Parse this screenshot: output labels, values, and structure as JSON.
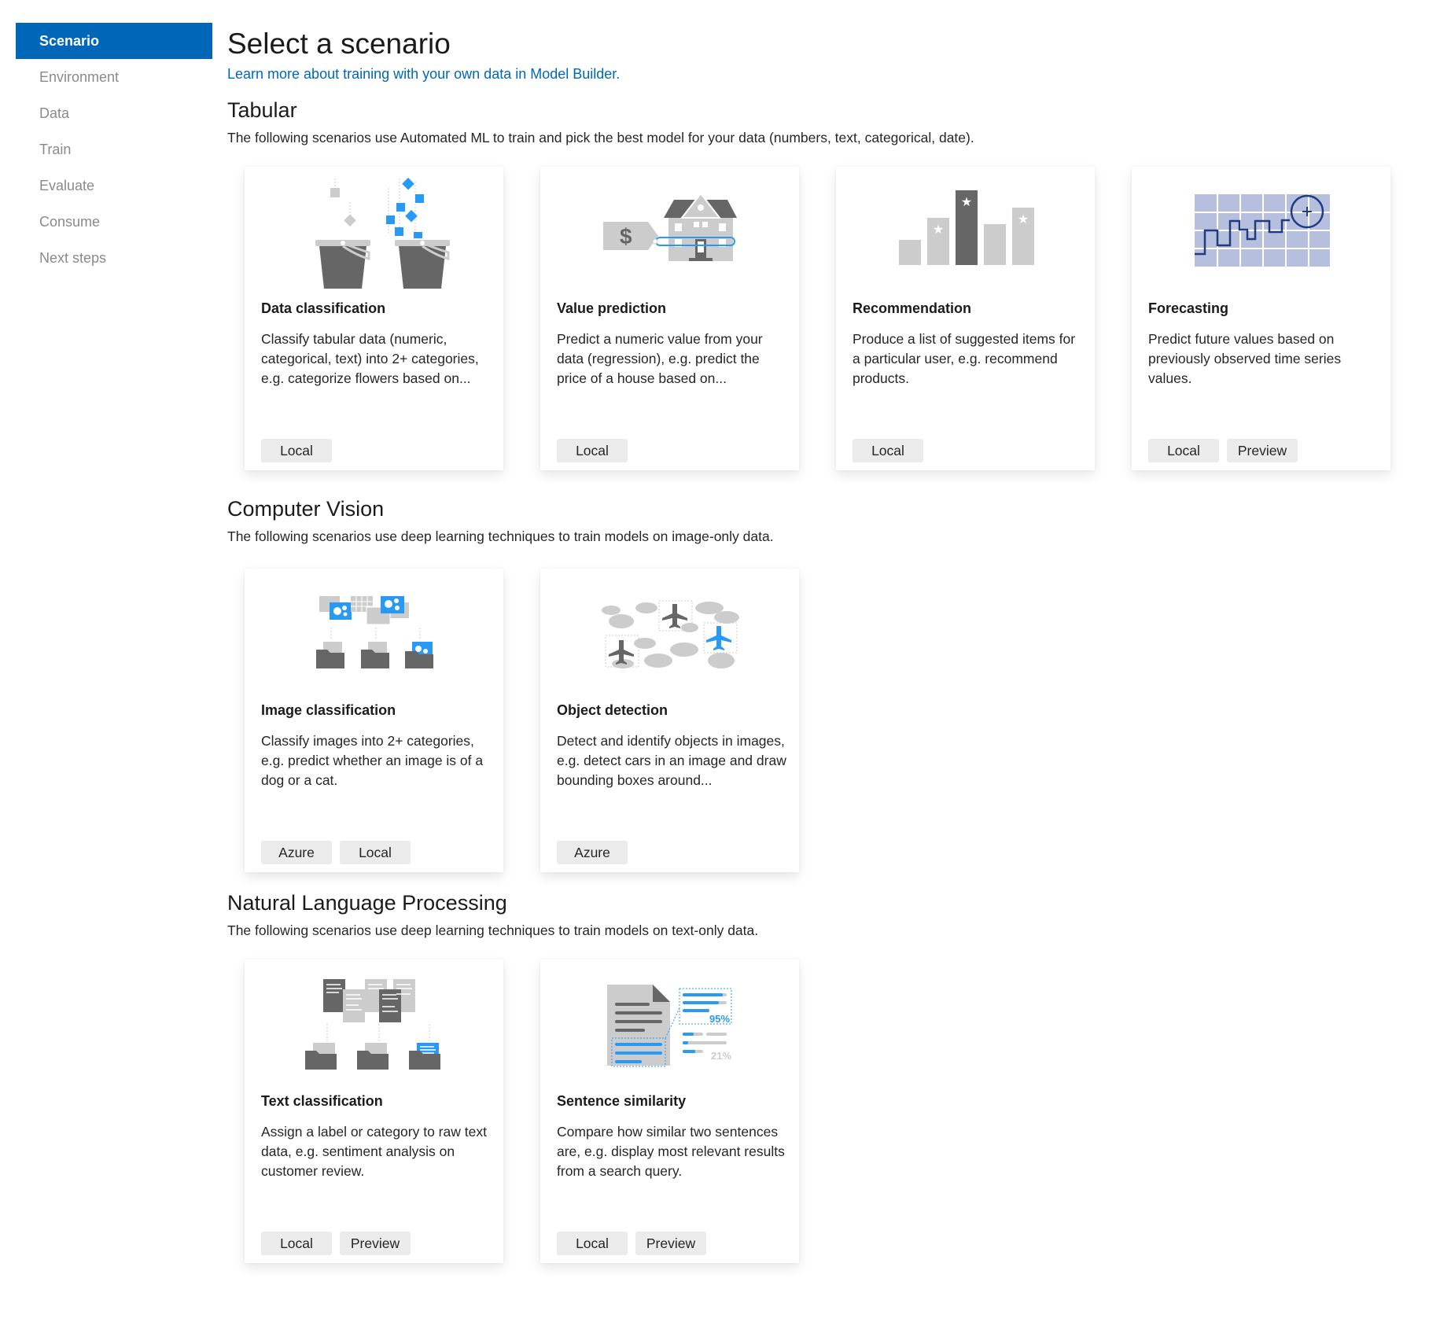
{
  "sidebar": {
    "items": [
      {
        "label": "Scenario",
        "active": true
      },
      {
        "label": "Environment",
        "active": false
      },
      {
        "label": "Data",
        "active": false
      },
      {
        "label": "Train",
        "active": false
      },
      {
        "label": "Evaluate",
        "active": false
      },
      {
        "label": "Consume",
        "active": false
      },
      {
        "label": "Next steps",
        "active": false
      }
    ]
  },
  "header": {
    "title": "Select a scenario",
    "learn_link": "Learn more about training with your own data in Model Builder."
  },
  "colors": {
    "accent": "#0067b8",
    "illustration_blue": "#2899f5",
    "illustration_dark": "#666666",
    "illustration_light": "#cccccc",
    "forecast_grid": "#b6c0de",
    "forecast_line": "#243a7e",
    "tag_bg": "#ebebeb"
  },
  "sections": [
    {
      "title": "Tabular",
      "description": "The following scenarios use Automated ML to train and pick the best model for your data (numbers, text, categorical, date).",
      "cards": [
        {
          "title": "Data classification",
          "icon": "buckets-icon",
          "description": "Classify tabular data (numeric, categorical, text) into 2+ categories, e.g. categorize flowers based on...",
          "tags": [
            "Local"
          ]
        },
        {
          "title": "Value prediction",
          "icon": "house-price-tag-icon",
          "description": "Predict a numeric value from your data (regression), e.g. predict the price of a house based on...",
          "tags": [
            "Local"
          ]
        },
        {
          "title": "Recommendation",
          "icon": "star-bar-chart-icon",
          "description": "Produce a list of suggested items for a particular user, e.g. recommend products.",
          "tags": [
            "Local"
          ]
        },
        {
          "title": "Forecasting",
          "icon": "time-series-forecast-icon",
          "description": "Predict future values based on previously observed time series values.",
          "tags": [
            "Local",
            "Preview"
          ]
        }
      ]
    },
    {
      "title": "Computer Vision",
      "description": "The following scenarios use deep learning techniques to train models on image-only data.",
      "cards": [
        {
          "title": "Image classification",
          "icon": "image-folders-icon",
          "description": "Classify images into 2+ categories, e.g. predict whether an image is of a dog or a cat.",
          "tags": [
            "Azure",
            "Local"
          ]
        },
        {
          "title": "Object detection",
          "icon": "airplanes-clouds-icon",
          "description": "Detect and identify objects in images, e.g. detect cars in an image and draw bounding boxes around...",
          "tags": [
            "Azure"
          ]
        }
      ]
    },
    {
      "title": "Natural Language Processing",
      "description": "The following scenarios use deep learning techniques to train models on text-only data.",
      "cards": [
        {
          "title": "Text classification",
          "icon": "document-folders-icon",
          "description": "Assign a label or category to raw text data, e.g. sentiment analysis on customer review.",
          "tags": [
            "Local",
            "Preview"
          ]
        },
        {
          "title": "Sentence similarity",
          "icon": "document-similarity-icon",
          "description": "Compare how similar two sentences are, e.g. display most relevant results from a search query.",
          "tags": [
            "Local",
            "Preview"
          ]
        },
        {
          "_illustration_labels": true
        }
      ]
    }
  ],
  "illustrations": {
    "similarity_high": "95%",
    "similarity_low": "21%"
  }
}
